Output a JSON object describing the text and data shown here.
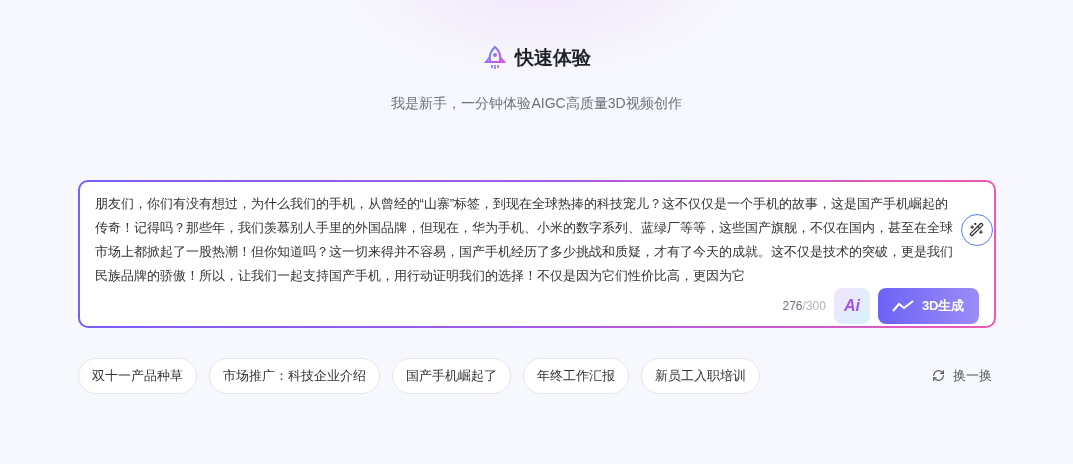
{
  "header": {
    "title": "快速体验",
    "subtitle": "我是新手，一分钟体验AIGC高质量3D视频创作"
  },
  "editor": {
    "text": "朋友们，你们有没有想过，为什么我们的手机，从曾经的“山寨”标签，到现在全球热捧的科技宠儿？这不仅仅是一个手机的故事，这是国产手机崛起的传奇！记得吗？那些年，我们羡慕别人手里的外国品牌，但现在，华为手机、小米的数字系列、蓝绿厂等等，这些国产旗舰，不仅在国内，甚至在全球市场上都掀起了一股热潮！但你知道吗？这一切来得并不容易，国产手机经历了多少挑战和质疑，才有了今天的成就。这不仅是技术的突破，更是我们民族品牌的骄傲！所以，让我们一起支持国产手机，用行动证明我们的选择！不仅是因为它们性价比高，更因为它",
    "count": "276",
    "limit": "/300",
    "ai_label": "Ai",
    "generate_label": "3D生成"
  },
  "suggestions": [
    {
      "label": "双十一产品种草"
    },
    {
      "label": "市场推广：科技企业介绍"
    },
    {
      "label": "国产手机崛起了"
    },
    {
      "label": "年终工作汇报"
    },
    {
      "label": "新员工入职培训"
    }
  ],
  "refresh": {
    "label": "换一换"
  }
}
